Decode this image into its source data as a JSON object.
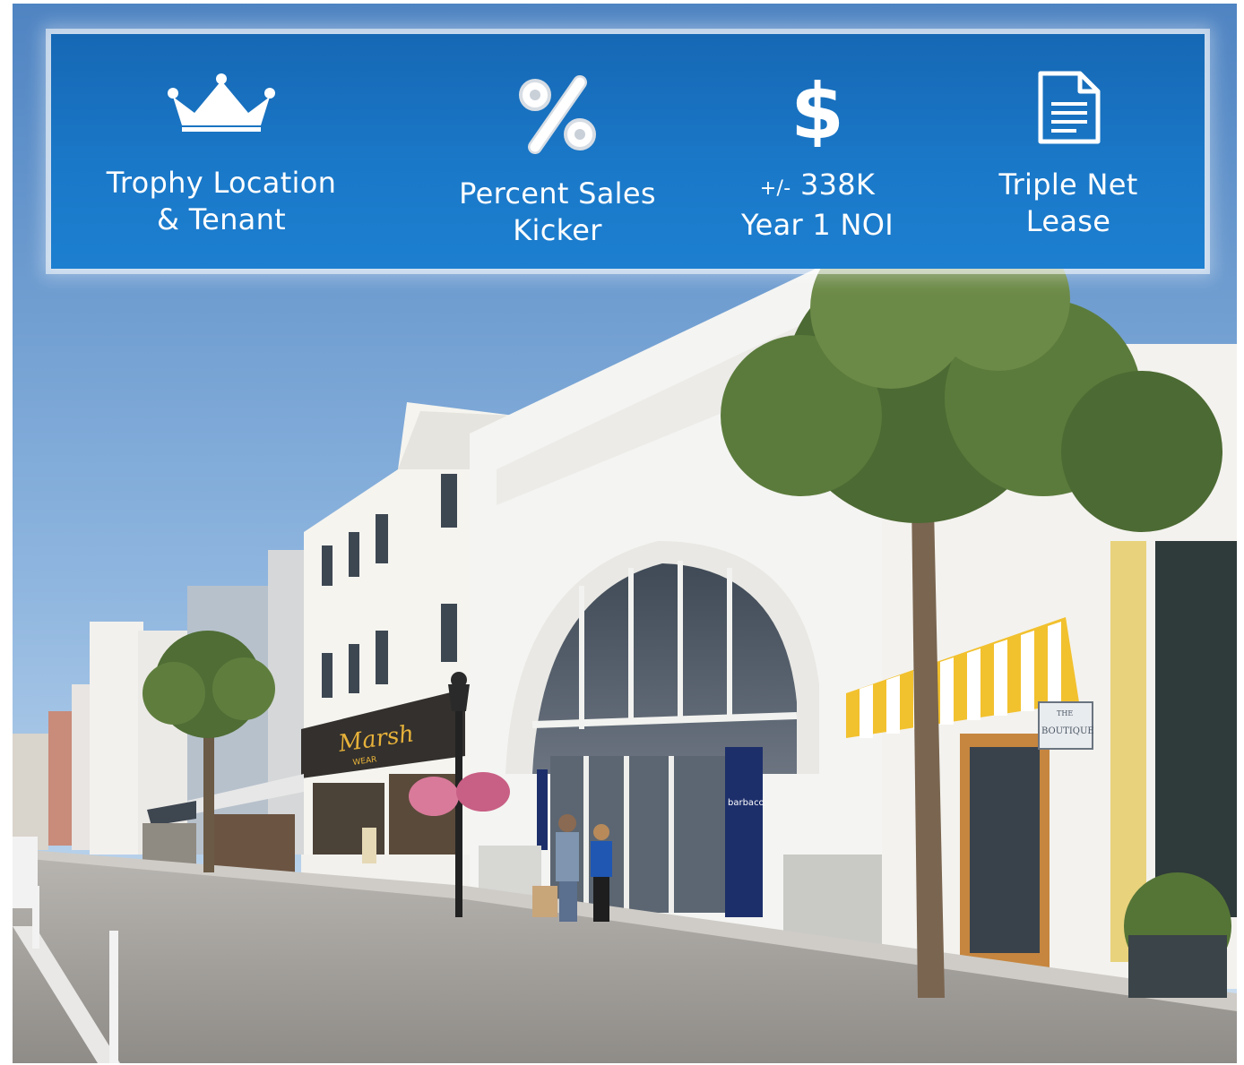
{
  "banner": {
    "features": [
      {
        "icon": "crown-icon",
        "label": "Trophy Location\n& Tenant"
      },
      {
        "icon": "percent-icon",
        "label": "Percent Sales\nKicker"
      },
      {
        "icon": "dollar-icon",
        "prefix": "+/-",
        "line1": " 338K",
        "line2": "Year 1 NOI"
      },
      {
        "icon": "document-icon",
        "label": "Triple Net\nLease"
      }
    ]
  },
  "photo": {
    "signs": {
      "marsh": "Marsh",
      "marsh_sub": "WEAR",
      "barbaco": "barbaco",
      "boutique": "BOUTIQUE",
      "boutique_top": "THE"
    },
    "colors": {
      "sky_top": "#5d8fc8",
      "sky_bottom": "#c9def2",
      "banner": "#1a74c4",
      "awning_yellow": "#f2c12e"
    }
  }
}
